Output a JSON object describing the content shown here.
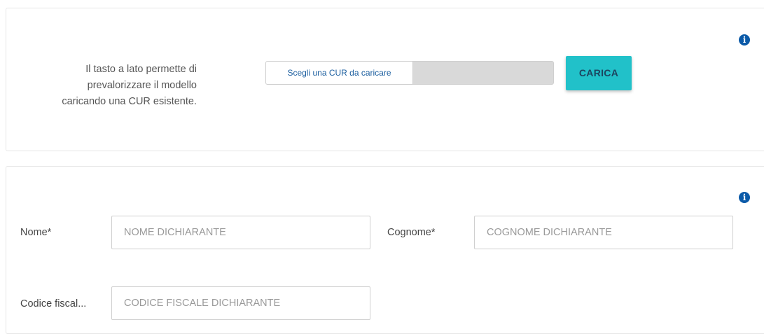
{
  "upload_section": {
    "description_lines": [
      "Il tasto a lato permette di",
      "prevalorizzare il modello",
      "caricando una CUR esistente."
    ],
    "file_picker_label": "Scegli una CUR da caricare",
    "upload_button_label": "CARICA",
    "info_icon": "info-icon"
  },
  "form_section": {
    "info_icon": "info-icon",
    "fields": {
      "nome": {
        "label": "Nome*",
        "placeholder": "NOME DICHIARANTE",
        "value": ""
      },
      "cognome": {
        "label": "Cognome*",
        "placeholder": "COGNOME DICHIARANTE",
        "value": ""
      },
      "codice_fiscale": {
        "label": "Codice fiscal...",
        "placeholder": "CODICE FISCALE DICHIARANTE",
        "value": ""
      }
    }
  },
  "colors": {
    "accent_button": "#21c1c9",
    "info_icon": "#0b5aa8",
    "file_picker_text": "#1b5e9f"
  }
}
